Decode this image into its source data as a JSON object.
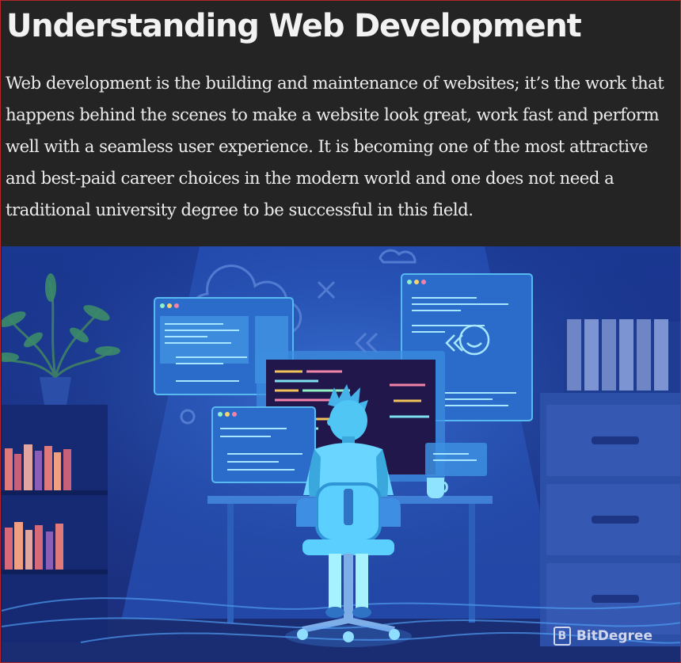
{
  "article": {
    "title": "Understanding Web Development",
    "paragraph": "Web development is the building and maintenance of websites; it’s the work that happens behind the scenes to make a website look great, work fast and perform well with a seamless user experience. It is becoming one of the most attractive and best-paid career choices in the modern world and one does not need a traditional university degree to be successful in this field."
  },
  "hero_image": {
    "watermark_text": "BitDegree",
    "watermark_logo_letter": "B"
  },
  "colors": {
    "page_background": "#242424",
    "title_text": "#f2f2f2",
    "body_text": "#ececec",
    "frame_border": "#b3262a",
    "illustration_background": "#1d3d93",
    "illustration_accent": "#5fd3ff"
  }
}
